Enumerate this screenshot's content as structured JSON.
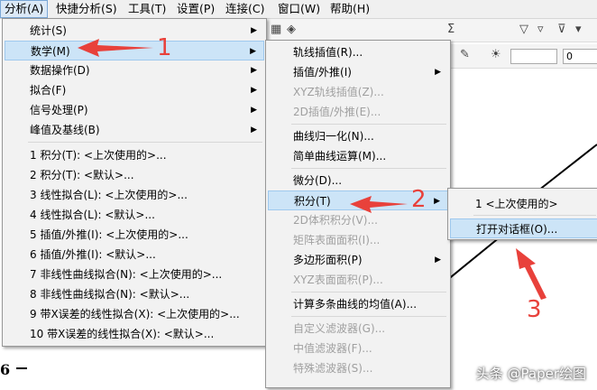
{
  "menubar": [
    {
      "label": "分析(A)",
      "active": true
    },
    {
      "label": "快捷分析(S)"
    },
    {
      "label": "工具(T)"
    },
    {
      "label": "设置(P)"
    },
    {
      "label": "连接(C)"
    },
    {
      "label": "窗口(W)"
    },
    {
      "label": "帮助(H)"
    }
  ],
  "menu1": {
    "group1": [
      {
        "label": "统计(S)",
        "arrow": true
      },
      {
        "label": "数学(M)",
        "arrow": true,
        "highlight": true
      },
      {
        "label": "数据操作(D)",
        "arrow": true
      },
      {
        "label": "拟合(F)",
        "arrow": true
      },
      {
        "label": "信号处理(P)",
        "arrow": true
      },
      {
        "label": "峰值及基线(B)",
        "arrow": true
      }
    ],
    "group2": [
      {
        "label": "1 积分(T): <上次使用的>..."
      },
      {
        "label": "2 积分(T): <默认>..."
      },
      {
        "label": "3 线性拟合(L): <上次使用的>..."
      },
      {
        "label": "4 线性拟合(L): <默认>..."
      },
      {
        "label": "5 插值/外推(I): <上次使用的>..."
      },
      {
        "label": "6 插值/外推(I): <默认>..."
      },
      {
        "label": "7 非线性曲线拟合(N): <上次使用的>..."
      },
      {
        "label": "8 非线性曲线拟合(N): <默认>..."
      },
      {
        "label": "9 带X误差的线性拟合(X): <上次使用的>..."
      },
      {
        "label": "10 带X误差的线性拟合(X): <默认>..."
      }
    ]
  },
  "menu2": [
    {
      "label": "轨线插值(R)...",
      "sep_before": false
    },
    {
      "label": "插值/外推(I)",
      "arrow": true
    },
    {
      "label": "XYZ轨线插值(Z)...",
      "disabled": true
    },
    {
      "label": "2D插值/外推(E)...",
      "disabled": true
    },
    {
      "label": "曲线归一化(N)...",
      "sep_before": true
    },
    {
      "label": "简单曲线运算(M)..."
    },
    {
      "label": "微分(D)...",
      "sep_before": true
    },
    {
      "label": "积分(T)",
      "arrow": true,
      "highlight": true
    },
    {
      "label": "2D体积积分(V)...",
      "disabled": true
    },
    {
      "label": "矩阵表面面积(I)...",
      "disabled": true
    },
    {
      "label": "多边形面积(P)",
      "arrow": true
    },
    {
      "label": "XYZ表面面积(P)...",
      "disabled": true
    },
    {
      "label": "计算多条曲线的均值(A)...",
      "sep_before": true
    },
    {
      "label": "自定义滤波器(G)...",
      "disabled": true,
      "sep_before": true
    },
    {
      "label": "中值滤波器(F)...",
      "disabled": true
    },
    {
      "label": "特殊滤波器(S)...",
      "disabled": true
    }
  ],
  "menu3": [
    {
      "label": "1 <上次使用的>"
    },
    {
      "label": "打开对话框(O)...",
      "highlight": true
    }
  ],
  "annotations": {
    "n1": "1",
    "n2": "2",
    "n3": "3",
    "arrow_color": "#e8413b"
  },
  "toolbar": {
    "field_value": "0"
  },
  "axis": {
    "tick_label": "6"
  },
  "watermark": "头条 @Paper绘图"
}
